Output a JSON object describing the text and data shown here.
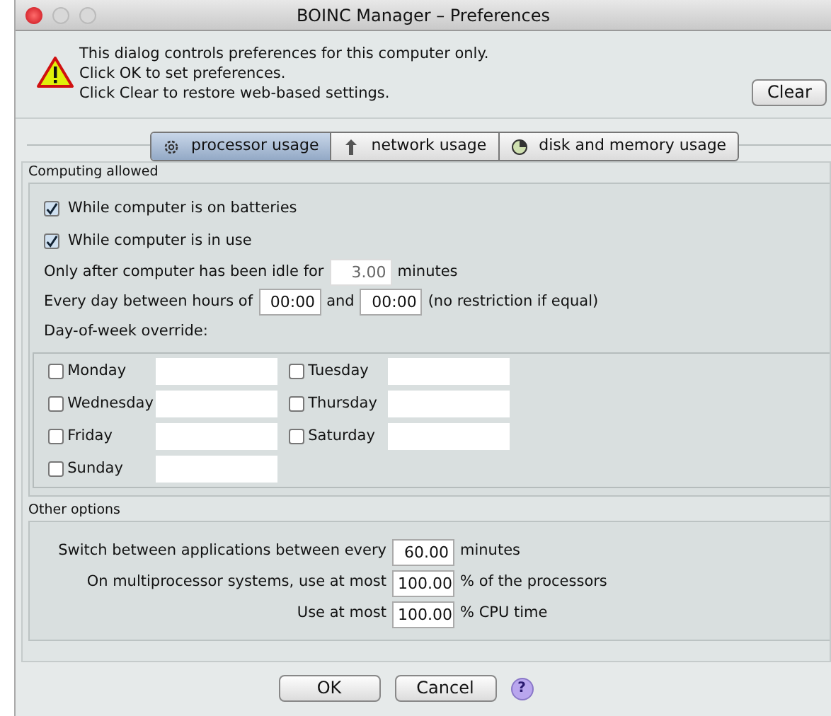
{
  "window": {
    "title": "BOINC Manager – Preferences"
  },
  "notice": {
    "lines": [
      "This dialog controls preferences for this computer only.",
      "Click OK to set preferences.",
      "Click Clear to restore web-based settings."
    ],
    "button": "Clear"
  },
  "tabs": [
    {
      "label": "processor usage",
      "selected": true,
      "kind": "gear"
    },
    {
      "label": "network usage",
      "selected": false,
      "kind": "arrows"
    },
    {
      "label": "disk and memory usage",
      "selected": false,
      "kind": "pie"
    }
  ],
  "computing_allowed": {
    "title": "Computing allowed",
    "checks": [
      {
        "label": "While computer is on batteries",
        "checked": true
      },
      {
        "label": "While computer is in use",
        "checked": true
      }
    ],
    "idle": {
      "before": "Only after computer has been idle for",
      "value": "3.00",
      "disabled": true,
      "after": "minutes"
    },
    "hours": {
      "before": "Every day between hours of",
      "start": "00:00",
      "middle": "and",
      "end": "00:00",
      "after": "(no restriction if equal)"
    },
    "override_title": "Day-of-week override:",
    "days": [
      {
        "label": "Monday",
        "checked": false
      },
      {
        "label": "Tuesday",
        "checked": false
      },
      {
        "label": "Wednesday",
        "checked": false
      },
      {
        "label": "Thursday",
        "checked": false
      },
      {
        "label": "Friday",
        "checked": false
      },
      {
        "label": "Saturday",
        "checked": false
      },
      {
        "label": "Sunday",
        "checked": false
      }
    ]
  },
  "other_options": {
    "title": "Other options",
    "rows": [
      {
        "label": "Switch between applications between every",
        "value": "60.00",
        "unit": "minutes"
      },
      {
        "label": "On multiprocessor systems, use at most",
        "value": "100.00",
        "unit": "% of the processors"
      },
      {
        "label": "Use at most",
        "value": "100.00",
        "unit": "% CPU time"
      }
    ]
  },
  "buttons": [
    {
      "label": "OK"
    },
    {
      "label": "Cancel"
    }
  ],
  "help": "?"
}
